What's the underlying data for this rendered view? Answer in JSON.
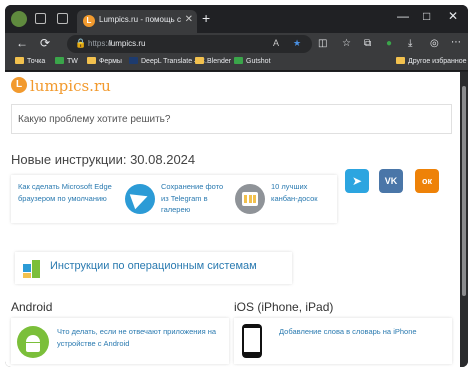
{
  "browser": {
    "tab_title": "Lumpics.ru - помощь с компьютером",
    "tab_favicon": "L",
    "new_tab": "+",
    "window_controls": [
      "—",
      "□",
      "✕"
    ],
    "address": {
      "protocol": "https://",
      "host": "lumpics.ru"
    },
    "nav": {
      "back": "←",
      "reload": "⟳",
      "home": "⌂"
    },
    "toolbar_icons": [
      "split-screen-icon",
      "favorites-icon",
      "collections-icon",
      "profile-icon",
      "extensions-icon",
      "more-icon"
    ]
  },
  "bookmarks": {
    "items": [
      {
        "label": "Точка",
        "icon": "folder"
      },
      {
        "label": "TW",
        "icon": "green"
      },
      {
        "label": "Фермы",
        "icon": "folder"
      },
      {
        "label": "DeepL Translate – С...",
        "icon": "navy"
      },
      {
        "label": "Blender",
        "icon": "folder"
      },
      {
        "label": "Gutshot",
        "icon": "green"
      }
    ],
    "other": "Другое избранное"
  },
  "page": {
    "logo_letter": "L",
    "logo_text": "lumpics.ru",
    "search_placeholder": "Какую проблему хотите решить?",
    "new_heading": "Новые инструкции: 30.08.2024",
    "new_cards": [
      {
        "text": "Как сделать Microsoft Edge браузером по умолчанию"
      },
      {
        "text": "Сохранение фото из Telegram в галерею"
      },
      {
        "text": "10 лучших канбан-досок"
      }
    ],
    "social": [
      {
        "name": "telegram",
        "glyph": "➤",
        "color": "#2ca5e0"
      },
      {
        "name": "vk",
        "glyph": "VK",
        "color": "#4a76a8"
      },
      {
        "name": "ok",
        "glyph": "ок",
        "color": "#ee8208"
      }
    ],
    "os_link": "Инструкции по операционным системам",
    "android_heading": "Android",
    "android_card": "Что делать, если не отвечают приложения на устройстве с Android",
    "ios_heading": "iOS (iPhone, iPad)",
    "ios_card": "Добавление слова в словарь на iPhone"
  }
}
